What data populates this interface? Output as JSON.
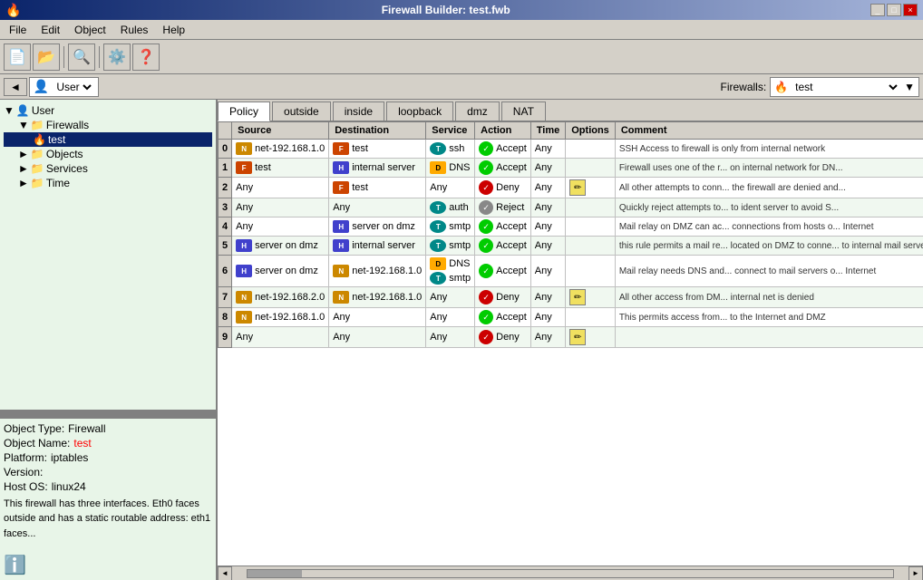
{
  "window": {
    "title": "Firewall Builder: test.fwb"
  },
  "title_bar": {
    "controls": [
      "_",
      "□",
      "×"
    ]
  },
  "menu": {
    "items": [
      "File",
      "Edit",
      "Object",
      "Rules",
      "Help"
    ]
  },
  "toolbar": {
    "buttons": [
      "new",
      "open",
      "save",
      "search",
      "settings",
      "help"
    ]
  },
  "nav": {
    "back_label": "◄",
    "dropdown_label": "User",
    "dropdown_icon": "▼"
  },
  "firewall_selector": {
    "label": "Firewalls:",
    "value": "test"
  },
  "tree": {
    "items": [
      {
        "label": "User",
        "level": 0,
        "icon": "folder"
      },
      {
        "label": "Firewalls",
        "level": 1,
        "icon": "folder"
      },
      {
        "label": "test",
        "level": 2,
        "icon": "firewall",
        "selected": true
      },
      {
        "label": "Objects",
        "level": 1,
        "icon": "folder"
      },
      {
        "label": "Services",
        "level": 1,
        "icon": "folder"
      },
      {
        "label": "Time",
        "level": 1,
        "icon": "folder"
      }
    ]
  },
  "info_panel": {
    "object_type_label": "Object Type:",
    "object_type_value": "Firewall",
    "object_name_label": "Object Name:",
    "object_name_value": "test",
    "platform_label": "Platform:",
    "platform_value": "iptables",
    "version_label": "Version:",
    "version_value": "",
    "host_os_label": "Host OS:",
    "host_os_value": "linux24",
    "description": "This firewall has three interfaces. Eth0 faces outside and has a static routable address: eth1 faces..."
  },
  "tabs": {
    "items": [
      "Policy",
      "outside",
      "inside",
      "loopback",
      "dmz",
      "NAT"
    ],
    "active": "Policy"
  },
  "table": {
    "columns": [
      "",
      "Source",
      "Destination",
      "Service",
      "Action",
      "Time",
      "Options",
      "Comment"
    ],
    "rows": [
      {
        "num": "0",
        "source": {
          "icon": "net",
          "label": "net-192.168.1.0"
        },
        "destination": {
          "icon": "fw",
          "label": "test"
        },
        "service": {
          "icon": "svc",
          "label": "ssh"
        },
        "action": {
          "type": "Accept",
          "icon": "accept"
        },
        "time": "Any",
        "options": "",
        "comment": "SSH Access to firewall is only from internal network"
      },
      {
        "num": "1",
        "source": {
          "icon": "fw",
          "label": "test"
        },
        "destination": {
          "icon": "host",
          "label": "internal server"
        },
        "service": {
          "icon": "dns",
          "label": "DNS"
        },
        "action": {
          "type": "Accept",
          "icon": "accept"
        },
        "time": "Any",
        "options": "",
        "comment": "Firewall uses one of the r... on internal network for DN..."
      },
      {
        "num": "2",
        "source": {
          "icon": "",
          "label": "Any"
        },
        "destination": {
          "icon": "fw",
          "label": "test"
        },
        "service": {
          "icon": "",
          "label": "Any"
        },
        "action": {
          "type": "Deny",
          "icon": "deny"
        },
        "time": "Any",
        "options": "edit",
        "comment": "All other attempts to conn... the firewall are denied and..."
      },
      {
        "num": "3",
        "source": {
          "icon": "",
          "label": "Any"
        },
        "destination": {
          "icon": "",
          "label": "Any"
        },
        "service": {
          "icon": "svc",
          "label": "auth"
        },
        "action": {
          "type": "Reject",
          "icon": "reject"
        },
        "time": "Any",
        "options": "",
        "comment": "Quickly reject attempts to... to ident server to avoid S..."
      },
      {
        "num": "4",
        "source": {
          "icon": "",
          "label": "Any"
        },
        "destination": {
          "icon": "host",
          "label": "server on dmz"
        },
        "service": {
          "icon": "svc",
          "label": "smtp"
        },
        "action": {
          "type": "Accept",
          "icon": "accept"
        },
        "time": "Any",
        "options": "",
        "comment": "Mail relay on DMZ can ac... connections from hosts o... Internet"
      },
      {
        "num": "5",
        "source": {
          "icon": "host",
          "label": "server on dmz"
        },
        "destination": {
          "icon": "host",
          "label": "internal server"
        },
        "service": {
          "icon": "svc",
          "label": "smtp"
        },
        "action": {
          "type": "Accept",
          "icon": "accept"
        },
        "time": "Any",
        "options": "",
        "comment": "this rule permits a mail re... located on DMZ to conne... to internal mail server"
      },
      {
        "num": "6",
        "source": {
          "icon": "host",
          "label": "server on dmz"
        },
        "destination": {
          "icon": "net",
          "label": "net-192.168.1.0"
        },
        "service": {
          "icon": "dns",
          "label": "DNS",
          "icon2": "svc",
          "label2": "smtp"
        },
        "action": {
          "type": "Accept",
          "icon": "accept"
        },
        "time": "Any",
        "options": "",
        "comment": "Mail relay needs DNS and... connect to mail servers o... Internet"
      },
      {
        "num": "7",
        "source": {
          "icon": "net",
          "label": "net-192.168.2.0"
        },
        "destination": {
          "icon": "net",
          "label": "net-192.168.1.0"
        },
        "service": {
          "icon": "",
          "label": "Any"
        },
        "action": {
          "type": "Deny",
          "icon": "deny"
        },
        "time": "Any",
        "options": "edit",
        "comment": "All other access from DM... internal net is denied"
      },
      {
        "num": "8",
        "source": {
          "icon": "net",
          "label": "net-192.168.1.0"
        },
        "destination": {
          "icon": "",
          "label": "Any"
        },
        "service": {
          "icon": "",
          "label": "Any"
        },
        "action": {
          "type": "Accept",
          "icon": "accept"
        },
        "time": "Any",
        "options": "",
        "comment": "This permits access from... to the Internet and DMZ"
      },
      {
        "num": "9",
        "source": {
          "icon": "",
          "label": "Any"
        },
        "destination": {
          "icon": "",
          "label": "Any"
        },
        "service": {
          "icon": "",
          "label": "Any"
        },
        "action": {
          "type": "Deny",
          "icon": "deny"
        },
        "time": "Any",
        "options": "edit",
        "comment": ""
      }
    ]
  }
}
